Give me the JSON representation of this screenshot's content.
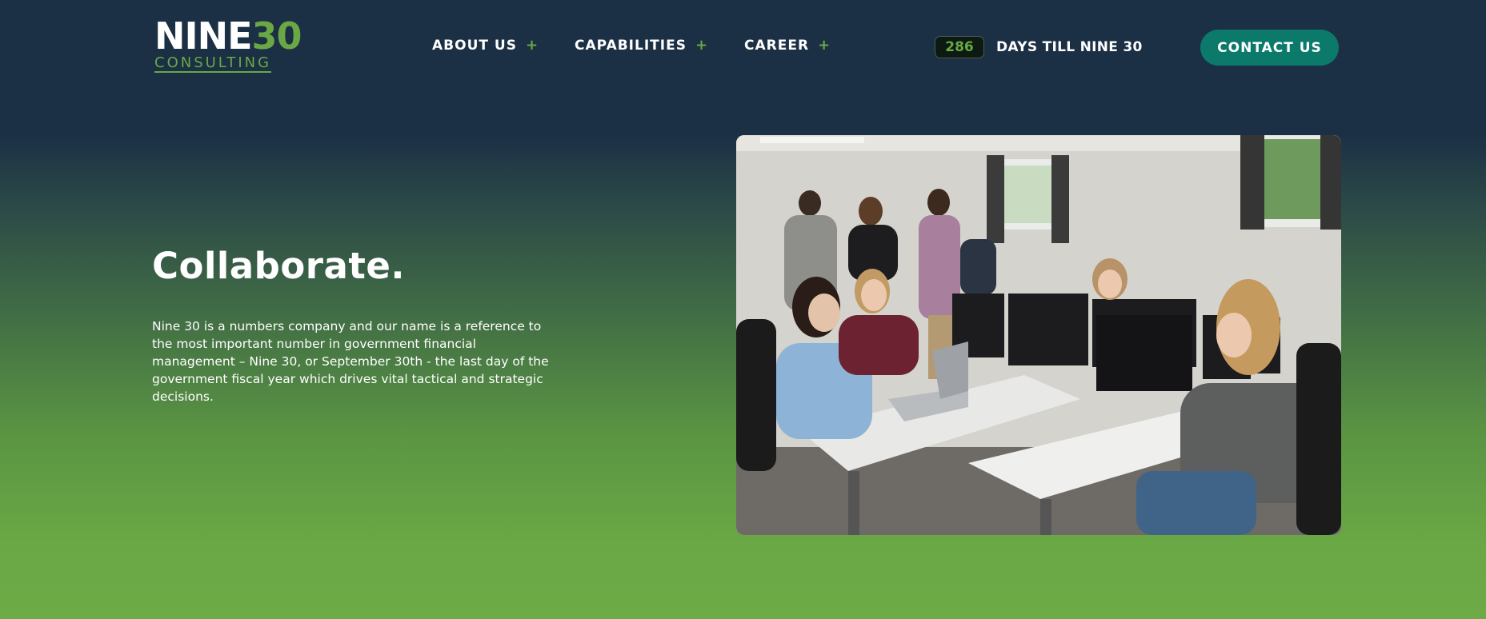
{
  "header": {
    "logo": {
      "top_white": "NINE",
      "top_green": "30",
      "bottom": "CONSULTING"
    },
    "nav": [
      {
        "label": "ABOUT US",
        "expand": "+"
      },
      {
        "label": "CAPABILITIES",
        "expand": "+"
      },
      {
        "label": "CAREER",
        "expand": "+"
      }
    ],
    "countdown": {
      "value": "286",
      "label": "DAYS TILL NINE 30"
    },
    "contact_label": "CONTACT US"
  },
  "hero": {
    "title": "Collaborate.",
    "body": "Nine 30 is a numbers company and our name is a reference to the most important number in government financial management – Nine 30, or September 30th - the last day of the government fiscal year which drives vital tactical and strategic decisions."
  },
  "colors": {
    "navy": "#1b2f45",
    "green": "#6aa845",
    "teal_button": "#0c7a6a"
  }
}
